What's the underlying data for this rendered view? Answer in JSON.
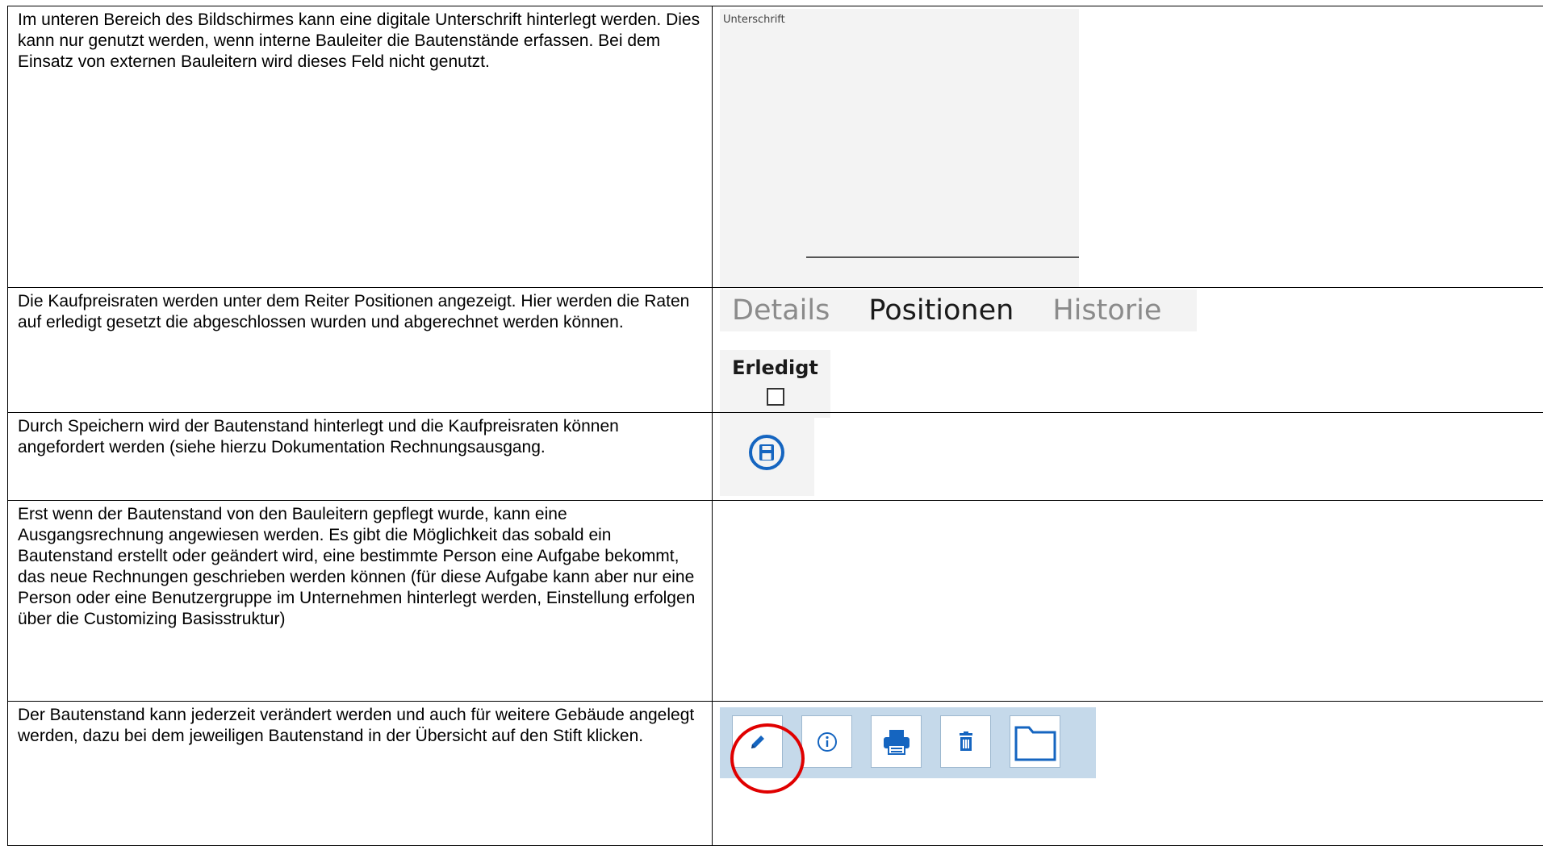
{
  "rows": [
    {
      "text": "Im unteren Bereich des Bildschirmes kann eine digitale Unterschrift hinterlegt werden. Dies kann nur genutzt werden, wenn interne Bauleiter die Bautenstände erfassen. Bei dem Einsatz von externen Bauleitern wird dieses Feld nicht genutzt."
    },
    {
      "text": "Die Kaufpreisraten werden unter dem Reiter Positionen angezeigt. Hier werden die Raten auf erledigt gesetzt die abgeschlossen wurden und abgerechnet werden können."
    },
    {
      "text": "Durch Speichern wird der Bautenstand hinterlegt und die Kaufpreisraten können angefordert werden (siehe hierzu Dokumentation Rechnungsausgang."
    },
    {
      "text": "Erst wenn der Bautenstand von den Bauleitern gepflegt wurde, kann eine Ausgangsrechnung angewiesen werden. Es gibt die Möglichkeit das sobald ein Bautenstand erstellt oder geändert wird, eine bestimmte Person eine Aufgabe bekommt, das neue Rechnungen geschrieben werden können (für diese Aufgabe kann aber nur eine Person oder eine Benutzergruppe im Unternehmen hinterlegt werden, Einstellung erfolgen über die Customizing Basisstruktur)"
    },
    {
      "text": "Der Bautenstand kann jederzeit verändert werden und auch für weitere Gebäude angelegt werden, dazu bei dem jeweiligen Bautenstand in der Übersicht auf den Stift klicken."
    }
  ],
  "signature": {
    "label": "Unterschrift"
  },
  "tabs": [
    {
      "label": "Details",
      "active": false
    },
    {
      "label": "Positionen",
      "active": true
    },
    {
      "label": "Historie",
      "active": false
    }
  ],
  "erledigt": {
    "label": "Erledigt",
    "checked": false
  },
  "toolbar": {
    "buttons": [
      "pencil-icon",
      "info-icon",
      "print-icon",
      "trash-icon",
      "folder-icon"
    ],
    "highlighted": "pencil-icon",
    "highlight_color": "#e00000",
    "icon_color": "#1565c0"
  }
}
